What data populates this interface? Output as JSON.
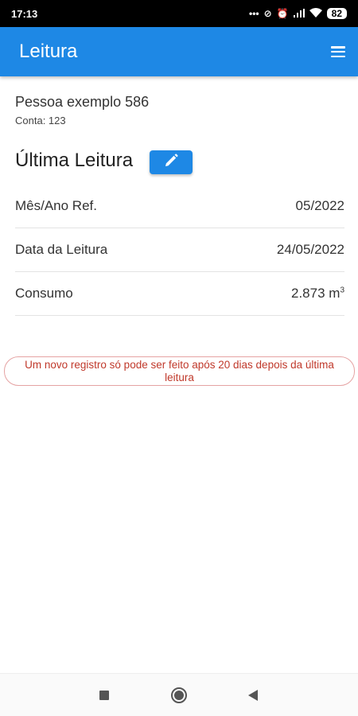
{
  "status_bar": {
    "time": "17:13",
    "icons": [
      "more-dots-icon",
      "sync-off-icon",
      "alarm-icon",
      "signal-icon",
      "wifi-icon"
    ],
    "battery": "82"
  },
  "app_bar": {
    "title": "Leitura",
    "menu_icon": "hamburger-menu-icon"
  },
  "person": {
    "name": "Pessoa exemplo 586",
    "account": "Conta: 123"
  },
  "reading": {
    "title": "Última Leitura",
    "edit_icon": "pencil-icon",
    "rows": [
      {
        "label": "Mês/Ano Ref.",
        "value": "05/2022"
      },
      {
        "label": "Data da Leitura",
        "value": "24/05/2022"
      },
      {
        "label": "Consumo",
        "value": "2.873 m",
        "unit_sup": "3"
      }
    ]
  },
  "notice": "Um novo registro só pode ser feito após 20 dias depois da última leitura",
  "colors": {
    "primary": "#1e88e5",
    "notice_text": "#c0392b",
    "notice_border": "#e5a3a3"
  },
  "nav_bar": {
    "buttons": [
      "recents-square-icon",
      "home-circle-icon",
      "back-triangle-icon"
    ]
  }
}
